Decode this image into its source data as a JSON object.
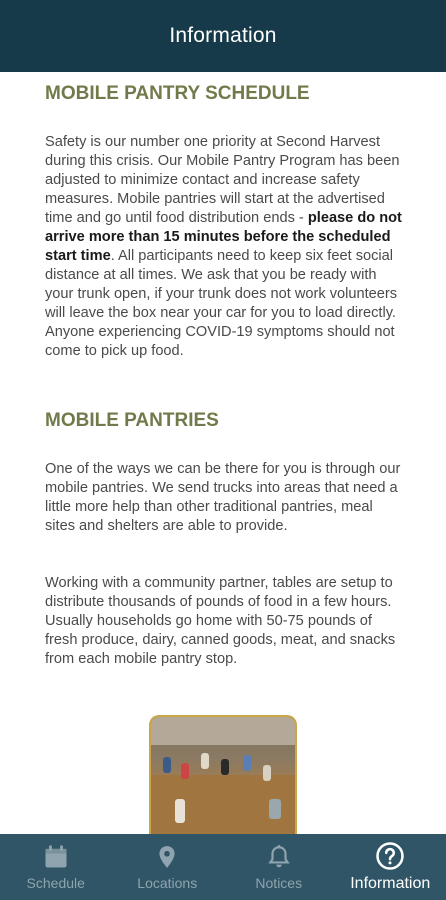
{
  "app_bar": {
    "title": "Information"
  },
  "section1": {
    "heading": "MOBILE PANTRY SCHEDULE",
    "text_a": "Safety is our number one priority at Second Harvest during this crisis. Our Mobile Pantry Program has been adjusted to minimize contact and increase safety measures. Mobile pantries will start at the advertised time and go until food distribution ends - ",
    "text_bold": "please do not arrive more than 15 minutes before the scheduled start time",
    "text_b": ". All participants need to keep six feet social distance at all times. We ask that you be ready with your trunk open, if your trunk does not work volunteers will leave the box near your car for you to load directly. Anyone experiencing COVID-19 symptoms should not come to pick up food."
  },
  "section2": {
    "heading": "MOBILE PANTRIES",
    "para1": "One of the ways we can be there for you is through our mobile pantries. We send trucks into areas that need a little more help than other traditional pantries, meal sites and shelters are able to provide.",
    "para2": "Working with a community partner, tables are setup to distribute thousands of pounds of food in a few hours. Usually households go home with 50-75 pounds of fresh produce, dairy, canned goods, meat, and snacks from each mobile pantry stop."
  },
  "nav": {
    "items": [
      {
        "label": "Schedule",
        "icon": "calendar-icon",
        "active": false
      },
      {
        "label": "Locations",
        "icon": "location-pin-icon",
        "active": false
      },
      {
        "label": "Notices",
        "icon": "bell-icon",
        "active": false
      },
      {
        "label": "Information",
        "icon": "question-circle-icon",
        "active": true
      }
    ]
  },
  "colors": {
    "app_bar": "#173a4a",
    "nav_bar": "#2f5566",
    "heading": "#707a4a",
    "photo_border": "#c9a646"
  }
}
